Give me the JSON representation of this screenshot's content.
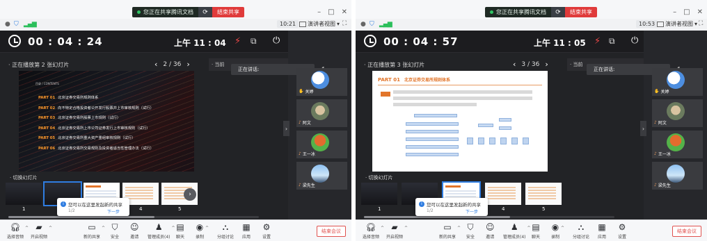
{
  "panels": [
    {
      "share_status": "您正在共享腾讯文档",
      "end_share": "结束共享",
      "clock_chip": "10:21",
      "view_label": "演讲者视图",
      "timer": "00 : 04 : 24",
      "clock": "上午 11 : 04",
      "now_playing": "正在播放第 2 张幻灯片",
      "page_indicator": "2 / 36",
      "side_label": "当前",
      "speaking": "正在讲话:",
      "switch_label": "切换幻灯片",
      "toc_label": "目录 / CONTENTS",
      "slide_items": [
        {
          "part": "PART 01",
          "text": "北京证券交易所规则体系"
        },
        {
          "part": "PART 02",
          "text": "向不特定合格投资者公开发行股票并上市审核规则（试行）"
        },
        {
          "part": "PART 03",
          "text": "北京证券交易所股票上市规则（试行）"
        },
        {
          "part": "PART 04",
          "text": "北京证券交易所上市公司证券发行上市审核规则（试行）"
        },
        {
          "part": "PART 05",
          "text": "北京证券交易所重大资产重组审核规则（试行）"
        },
        {
          "part": "PART 06",
          "text": "北京证券交易所交易规则及投资者适当性管理办法（试行）"
        }
      ],
      "thumb_numbers": [
        "1",
        "4",
        "5"
      ],
      "popup": {
        "message": "您可以在这里发起新的共享",
        "count": "1/2",
        "next": "下一步"
      }
    },
    {
      "share_status": "您正在共享腾讯文档",
      "end_share": "结束共享",
      "clock_chip": "10:53",
      "view_label": "演讲者视图",
      "timer": "00 : 04 : 57",
      "clock": "上午 11 : 05",
      "now_playing": "正在播放第 3 张幻灯片",
      "page_indicator": "3 / 36",
      "side_label": "当前",
      "speaking": "正在讲话:",
      "switch_label": "切换幻灯片",
      "slide_part": "PART 01",
      "slide_title": "北京证券交易所规则体系",
      "thumb_numbers": [
        "1",
        "4",
        "5"
      ],
      "popup": {
        "message": "您可以在这里发起新的共享",
        "count": "1/2",
        "next": "下一步"
      }
    }
  ],
  "participants": [
    {
      "name": "关婷",
      "icon": "hand-icon"
    },
    {
      "name": "阿文",
      "icon": "mic-icon"
    },
    {
      "name": "王一冰",
      "icon": "mic-icon"
    },
    {
      "name": "梁先生",
      "icon": "mic-icon"
    }
  ],
  "toolbar": {
    "items": [
      {
        "label": "选择音频",
        "icon": "headset-icon"
      },
      {
        "label": "开启视频",
        "icon": "camera-off-icon"
      },
      {
        "label": "新的共享",
        "icon": "share-screen-icon"
      },
      {
        "label": "安全",
        "icon": "shield-icon"
      },
      {
        "label": "邀请",
        "icon": "invite-icon"
      },
      {
        "label": "管理成员(4)",
        "icon": "members-icon"
      },
      {
        "label": "聊天",
        "icon": "chat-icon"
      },
      {
        "label": "录制",
        "icon": "record-icon"
      },
      {
        "label": "分组讨论",
        "icon": "breakout-icon"
      },
      {
        "label": "应用",
        "icon": "apps-icon"
      },
      {
        "label": "设置",
        "icon": "settings-icon"
      }
    ],
    "end_meeting": "结束会议"
  },
  "colors": {
    "accent_blue": "#2f7de1",
    "end_red": "#e0524f",
    "slide_orange": "#e2752a"
  }
}
